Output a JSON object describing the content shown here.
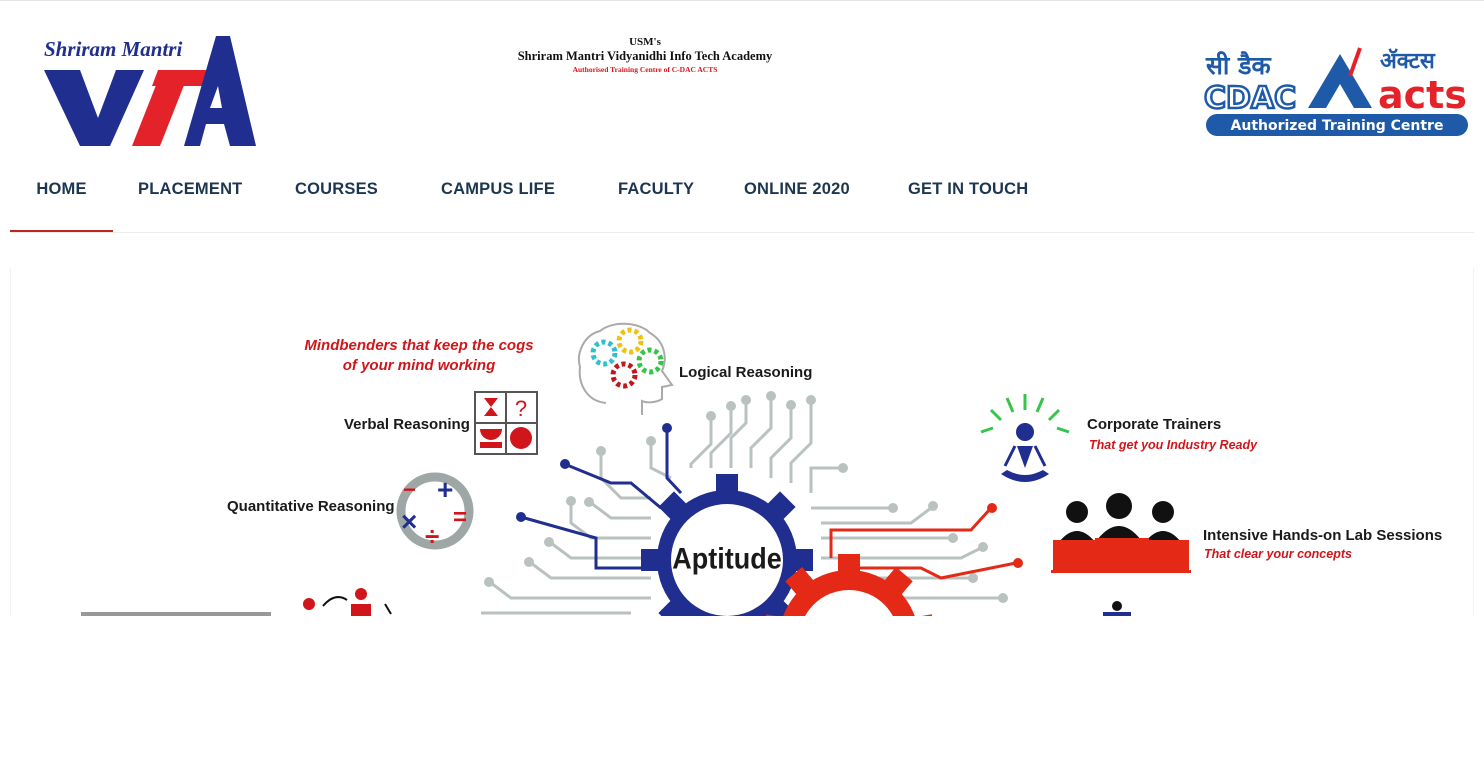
{
  "header": {
    "logo_text": "Shriram Mantri",
    "logo_mark": "VITA",
    "academy": {
      "line1": "USM's",
      "line2": "Shriram Mantri Vidyanidhi Info Tech Academy",
      "line3": "Authorised Training Centre of C-DAC ACTS"
    },
    "partner": {
      "cdac_hindi": "सी डैक",
      "cdac": "CDAC",
      "acts_hindi": "ॲक्टस",
      "acts": "acts",
      "badge": "Authorized Training Centre"
    }
  },
  "nav": {
    "items": [
      {
        "label": "HOME",
        "active": true
      },
      {
        "label": "PLACEMENT"
      },
      {
        "label": "COURSES"
      },
      {
        "label": "CAMPUS LIFE"
      },
      {
        "label": "FACULTY"
      },
      {
        "label": "ONLINE 2020"
      },
      {
        "label": "GET IN TOUCH"
      }
    ]
  },
  "banner": {
    "tagline1": "Mindbenders that keep the cogs",
    "tagline2": "of your mind working",
    "logical": "Logical Reasoning",
    "verbal": "Verbal Reasoning",
    "quantitative": "Quantitative Reasoning",
    "center": "Aptitude",
    "corporate_title": "Corporate Trainers",
    "corporate_sub": "That get you Industry Ready",
    "lab_title": "Intensive Hands-on Lab Sessions",
    "lab_sub": "That clear your concepts",
    "colors": {
      "navy": "#1f2e8f",
      "red": "#e42a17",
      "gray": "#b9c1c1",
      "dark": "#1a1a1a"
    }
  }
}
